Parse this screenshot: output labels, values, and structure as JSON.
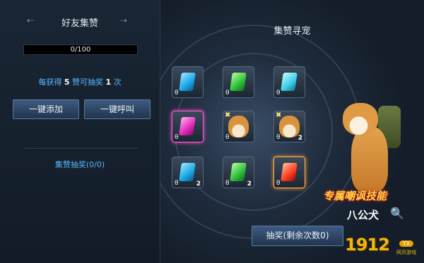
{
  "left_panel": {
    "title": "好友集赞",
    "progress": {
      "text": "0/100",
      "fraction": 0.0
    },
    "rule": {
      "prefix": "每获得",
      "likes": "5",
      "middle": "赞可抽奖",
      "draws": "1",
      "suffix": "次"
    },
    "buttons": {
      "add_all": "一键添加",
      "call_all": "一键呼叫"
    },
    "draw_count": "集赞抽奖(0/0)"
  },
  "right_panel": {
    "title": "集赞寻宠",
    "items": [
      {
        "kind": "gem",
        "color": "blue",
        "count": ""
      },
      {
        "kind": "gem",
        "color": "green",
        "count": ""
      },
      {
        "kind": "gem",
        "color": "cyan",
        "count": ""
      },
      {
        "kind": "gem",
        "color": "pink",
        "count": "",
        "highlight": "pink"
      },
      {
        "kind": "dog",
        "count": ""
      },
      {
        "kind": "dog",
        "count": "2"
      },
      {
        "kind": "gem",
        "color": "blue",
        "count": "2"
      },
      {
        "kind": "gem",
        "color": "green",
        "count": "2"
      },
      {
        "kind": "gem",
        "color": "red",
        "count": "",
        "highlight": "orange"
      }
    ],
    "skill_text": "专属嘲讽技能",
    "pet_name": "八公犬",
    "draw_button": "抽奖(剩余次数0)",
    "lock_glyph": "θ"
  },
  "watermark": {
    "number": "1912",
    "badge": "YX",
    "text": "网页游戏"
  },
  "icons": {
    "left_arrow": "arrow-left-icon",
    "right_arrow": "arrow-right-icon",
    "search": "magnifier-icon",
    "lock": "lock-icon",
    "star": "star-icon"
  }
}
